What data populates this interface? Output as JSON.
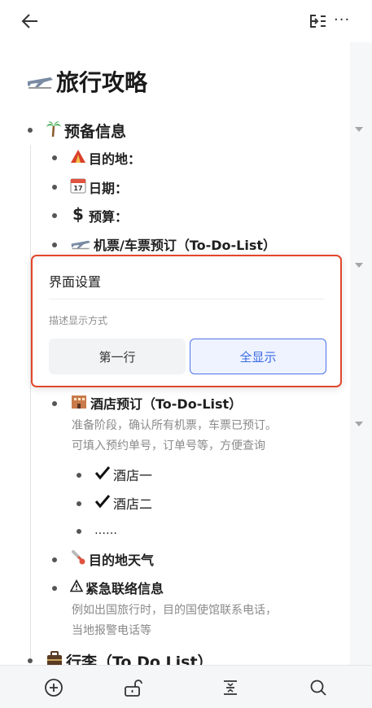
{
  "doc": {
    "title": "旅行攻略",
    "title_icon": "airplane-icon"
  },
  "outline": [
    {
      "label": "预备信息",
      "icon": "palm-tree-icon"
    },
    {
      "label": "目的地：",
      "icon": "tent-icon"
    },
    {
      "label": "日期：",
      "icon": "calendar-icon"
    },
    {
      "label": "预算：",
      "icon": "dollar-icon"
    },
    {
      "label": "机票/车票预订（To-Do-List）",
      "icon": "airplane-icon"
    },
    {
      "label": "酒店预订（To-Do-List）",
      "icon": "hotel-icon",
      "note": [
        "准备阶段，确认所有机票，车票已预订。",
        "可填入预约单号，订单号等，方便查询"
      ]
    },
    {
      "label": "酒店一",
      "icon": "check-icon"
    },
    {
      "label": "酒店二",
      "icon": "check-icon"
    },
    {
      "label": "……"
    },
    {
      "label": "目的地天气",
      "icon": "thermometer-icon"
    },
    {
      "label": "紧急联络信息",
      "icon": "warning-icon",
      "note": [
        "例如出国旅行时，目的国使馆联系电话，",
        "当地报警电话等"
      ]
    },
    {
      "label": "行李（To Do List）",
      "icon": "luggage-icon"
    }
  ],
  "popup": {
    "title": "界面设置",
    "desc": "描述显示方式",
    "option_a": "第一行",
    "option_b": "全显示",
    "selected": "全显示"
  },
  "topbar": {
    "more": "···"
  },
  "colors": {
    "accent": "#3b6ae4",
    "highlight_border": "#e2482b",
    "text": "#1f1f1f",
    "muted": "#8a8a8a"
  }
}
